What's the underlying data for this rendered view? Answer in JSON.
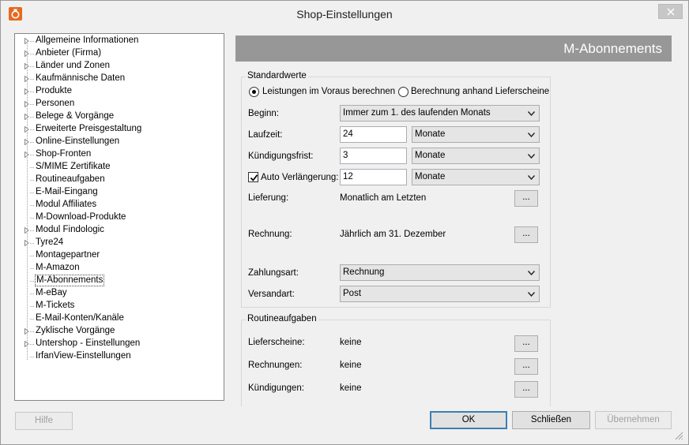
{
  "window": {
    "title": "Shop-Einstellungen"
  },
  "tree": {
    "items": [
      {
        "label": "Allgemeine Informationen",
        "expandable": true
      },
      {
        "label": "Anbieter (Firma)",
        "expandable": true
      },
      {
        "label": "Länder und Zonen",
        "expandable": true
      },
      {
        "label": "Kaufmännische Daten",
        "expandable": true
      },
      {
        "label": "Produkte",
        "expandable": true
      },
      {
        "label": "Personen",
        "expandable": true
      },
      {
        "label": "Belege & Vorgänge",
        "expandable": true
      },
      {
        "label": "Erweiterte Preisgestaltung",
        "expandable": true
      },
      {
        "label": "Online-Einstellungen",
        "expandable": true
      },
      {
        "label": "Shop-Fronten",
        "expandable": true
      },
      {
        "label": "S/MIME Zertifikate",
        "expandable": false
      },
      {
        "label": "Routineaufgaben",
        "expandable": false
      },
      {
        "label": "E-Mail-Eingang",
        "expandable": false
      },
      {
        "label": "Modul Affiliates",
        "expandable": false
      },
      {
        "label": "M-Download-Produkte",
        "expandable": false
      },
      {
        "label": "Modul Findologic",
        "expandable": true
      },
      {
        "label": "Tyre24",
        "expandable": true
      },
      {
        "label": "Montagepartner",
        "expandable": false
      },
      {
        "label": "M-Amazon",
        "expandable": false
      },
      {
        "label": "M-Abonnements",
        "expandable": false,
        "selected": true
      },
      {
        "label": "M-eBay",
        "expandable": false
      },
      {
        "label": "M-Tickets",
        "expandable": false
      },
      {
        "label": "E-Mail-Konten/Kanäle",
        "expandable": false
      },
      {
        "label": "Zyklische Vorgänge",
        "expandable": true
      },
      {
        "label": "Untershop - Einstellungen",
        "expandable": true
      },
      {
        "label": "IrfanView-Einstellungen",
        "expandable": false
      }
    ]
  },
  "panel": {
    "header": "M-Abonnements",
    "standard": {
      "title": "Standardwerte",
      "radio1": "Leistungen im Voraus berechnen",
      "radio2": "Berechnung anhand Lieferscheine",
      "beginn_label": "Beginn:",
      "beginn_value": "Immer zum 1. des laufenden Monats",
      "laufzeit_label": "Laufzeit:",
      "laufzeit_value": "24",
      "laufzeit_unit": "Monate",
      "kuendigung_label": "Kündigungsfrist:",
      "kuendigung_value": "3",
      "kuendigung_unit": "Monate",
      "auto_label": "Auto Verlängerung:",
      "auto_checked": true,
      "auto_value": "12",
      "auto_unit": "Monate",
      "lieferung_label": "Lieferung:",
      "lieferung_value": "Monatlich am Letzten",
      "rechnung_label": "Rechnung:",
      "rechnung_value": "Jährlich am 31. Dezember",
      "zahlungsart_label": "Zahlungsart:",
      "zahlungsart_value": "Rechnung",
      "versandart_label": "Versandart:",
      "versandart_value": "Post",
      "dots": "..."
    },
    "routine": {
      "title": "Routineaufgaben",
      "lieferscheine_label": "Lieferscheine:",
      "lieferscheine_value": "keine",
      "rechnungen_label": "Rechnungen:",
      "rechnungen_value": "keine",
      "kuendigungen_label": "Kündigungen:",
      "kuendigungen_value": "keine",
      "dots": "..."
    }
  },
  "footer": {
    "help": "Hilfe",
    "ok": "OK",
    "close": "Schließen",
    "apply": "Übernehmen"
  }
}
